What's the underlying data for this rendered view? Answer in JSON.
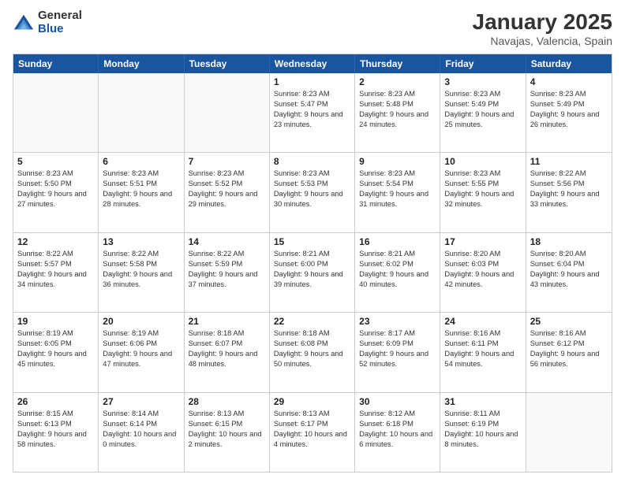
{
  "logo": {
    "general": "General",
    "blue": "Blue"
  },
  "header": {
    "month": "January 2025",
    "location": "Navajas, Valencia, Spain"
  },
  "weekdays": [
    "Sunday",
    "Monday",
    "Tuesday",
    "Wednesday",
    "Thursday",
    "Friday",
    "Saturday"
  ],
  "weeks": [
    [
      {
        "day": "",
        "sunrise": "",
        "sunset": "",
        "daylight": ""
      },
      {
        "day": "",
        "sunrise": "",
        "sunset": "",
        "daylight": ""
      },
      {
        "day": "",
        "sunrise": "",
        "sunset": "",
        "daylight": ""
      },
      {
        "day": "1",
        "sunrise": "Sunrise: 8:23 AM",
        "sunset": "Sunset: 5:47 PM",
        "daylight": "Daylight: 9 hours and 23 minutes."
      },
      {
        "day": "2",
        "sunrise": "Sunrise: 8:23 AM",
        "sunset": "Sunset: 5:48 PM",
        "daylight": "Daylight: 9 hours and 24 minutes."
      },
      {
        "day": "3",
        "sunrise": "Sunrise: 8:23 AM",
        "sunset": "Sunset: 5:49 PM",
        "daylight": "Daylight: 9 hours and 25 minutes."
      },
      {
        "day": "4",
        "sunrise": "Sunrise: 8:23 AM",
        "sunset": "Sunset: 5:49 PM",
        "daylight": "Daylight: 9 hours and 26 minutes."
      }
    ],
    [
      {
        "day": "5",
        "sunrise": "Sunrise: 8:23 AM",
        "sunset": "Sunset: 5:50 PM",
        "daylight": "Daylight: 9 hours and 27 minutes."
      },
      {
        "day": "6",
        "sunrise": "Sunrise: 8:23 AM",
        "sunset": "Sunset: 5:51 PM",
        "daylight": "Daylight: 9 hours and 28 minutes."
      },
      {
        "day": "7",
        "sunrise": "Sunrise: 8:23 AM",
        "sunset": "Sunset: 5:52 PM",
        "daylight": "Daylight: 9 hours and 29 minutes."
      },
      {
        "day": "8",
        "sunrise": "Sunrise: 8:23 AM",
        "sunset": "Sunset: 5:53 PM",
        "daylight": "Daylight: 9 hours and 30 minutes."
      },
      {
        "day": "9",
        "sunrise": "Sunrise: 8:23 AM",
        "sunset": "Sunset: 5:54 PM",
        "daylight": "Daylight: 9 hours and 31 minutes."
      },
      {
        "day": "10",
        "sunrise": "Sunrise: 8:23 AM",
        "sunset": "Sunset: 5:55 PM",
        "daylight": "Daylight: 9 hours and 32 minutes."
      },
      {
        "day": "11",
        "sunrise": "Sunrise: 8:22 AM",
        "sunset": "Sunset: 5:56 PM",
        "daylight": "Daylight: 9 hours and 33 minutes."
      }
    ],
    [
      {
        "day": "12",
        "sunrise": "Sunrise: 8:22 AM",
        "sunset": "Sunset: 5:57 PM",
        "daylight": "Daylight: 9 hours and 34 minutes."
      },
      {
        "day": "13",
        "sunrise": "Sunrise: 8:22 AM",
        "sunset": "Sunset: 5:58 PM",
        "daylight": "Daylight: 9 hours and 36 minutes."
      },
      {
        "day": "14",
        "sunrise": "Sunrise: 8:22 AM",
        "sunset": "Sunset: 5:59 PM",
        "daylight": "Daylight: 9 hours and 37 minutes."
      },
      {
        "day": "15",
        "sunrise": "Sunrise: 8:21 AM",
        "sunset": "Sunset: 6:00 PM",
        "daylight": "Daylight: 9 hours and 39 minutes."
      },
      {
        "day": "16",
        "sunrise": "Sunrise: 8:21 AM",
        "sunset": "Sunset: 6:02 PM",
        "daylight": "Daylight: 9 hours and 40 minutes."
      },
      {
        "day": "17",
        "sunrise": "Sunrise: 8:20 AM",
        "sunset": "Sunset: 6:03 PM",
        "daylight": "Daylight: 9 hours and 42 minutes."
      },
      {
        "day": "18",
        "sunrise": "Sunrise: 8:20 AM",
        "sunset": "Sunset: 6:04 PM",
        "daylight": "Daylight: 9 hours and 43 minutes."
      }
    ],
    [
      {
        "day": "19",
        "sunrise": "Sunrise: 8:19 AM",
        "sunset": "Sunset: 6:05 PM",
        "daylight": "Daylight: 9 hours and 45 minutes."
      },
      {
        "day": "20",
        "sunrise": "Sunrise: 8:19 AM",
        "sunset": "Sunset: 6:06 PM",
        "daylight": "Daylight: 9 hours and 47 minutes."
      },
      {
        "day": "21",
        "sunrise": "Sunrise: 8:18 AM",
        "sunset": "Sunset: 6:07 PM",
        "daylight": "Daylight: 9 hours and 48 minutes."
      },
      {
        "day": "22",
        "sunrise": "Sunrise: 8:18 AM",
        "sunset": "Sunset: 6:08 PM",
        "daylight": "Daylight: 9 hours and 50 minutes."
      },
      {
        "day": "23",
        "sunrise": "Sunrise: 8:17 AM",
        "sunset": "Sunset: 6:09 PM",
        "daylight": "Daylight: 9 hours and 52 minutes."
      },
      {
        "day": "24",
        "sunrise": "Sunrise: 8:16 AM",
        "sunset": "Sunset: 6:11 PM",
        "daylight": "Daylight: 9 hours and 54 minutes."
      },
      {
        "day": "25",
        "sunrise": "Sunrise: 8:16 AM",
        "sunset": "Sunset: 6:12 PM",
        "daylight": "Daylight: 9 hours and 56 minutes."
      }
    ],
    [
      {
        "day": "26",
        "sunrise": "Sunrise: 8:15 AM",
        "sunset": "Sunset: 6:13 PM",
        "daylight": "Daylight: 9 hours and 58 minutes."
      },
      {
        "day": "27",
        "sunrise": "Sunrise: 8:14 AM",
        "sunset": "Sunset: 6:14 PM",
        "daylight": "Daylight: 10 hours and 0 minutes."
      },
      {
        "day": "28",
        "sunrise": "Sunrise: 8:13 AM",
        "sunset": "Sunset: 6:15 PM",
        "daylight": "Daylight: 10 hours and 2 minutes."
      },
      {
        "day": "29",
        "sunrise": "Sunrise: 8:13 AM",
        "sunset": "Sunset: 6:17 PM",
        "daylight": "Daylight: 10 hours and 4 minutes."
      },
      {
        "day": "30",
        "sunrise": "Sunrise: 8:12 AM",
        "sunset": "Sunset: 6:18 PM",
        "daylight": "Daylight: 10 hours and 6 minutes."
      },
      {
        "day": "31",
        "sunrise": "Sunrise: 8:11 AM",
        "sunset": "Sunset: 6:19 PM",
        "daylight": "Daylight: 10 hours and 8 minutes."
      },
      {
        "day": "",
        "sunrise": "",
        "sunset": "",
        "daylight": ""
      }
    ]
  ]
}
